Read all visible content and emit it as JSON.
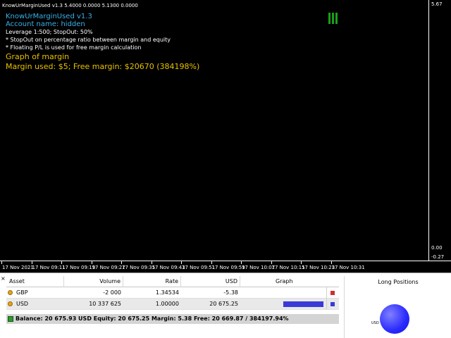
{
  "chart": {
    "header": "KnowUrMarginUsed v1.3 5.4000 0.0000 5.1300 0.0000",
    "info": {
      "version": "KnowUrMarginUsed v1.3",
      "account": "Account name: hidden",
      "leverage": "Leverage 1:500; StopOut: 50%",
      "note1": "* StopOut on percentage ratio between margin and equity",
      "note2": "* Floating P/L is used for free margin calculation",
      "graph_title": "Graph of margin",
      "margin_line": "Margin used: $5; Free margin: $20670 (384198%)"
    },
    "price_labels": [
      "5.67",
      "0.00",
      "-0.27"
    ],
    "time_labels": [
      "17 Nov 2021",
      "17 Nov 09:11",
      "17 Nov 09:19",
      "17 Nov 09:27",
      "17 Nov 09:35",
      "17 Nov 09:43",
      "17 Nov 09:51",
      "17 Nov 09:59",
      "17 Nov 10:07",
      "17 Nov 10:15",
      "17 Nov 10:23",
      "17 Nov 10:31"
    ],
    "indicator_color": "#19a019"
  },
  "panel": {
    "close_label": "×",
    "headers": {
      "asset": "Asset",
      "volume": "Volume",
      "rate": "Rate",
      "usd": "USD",
      "graph": "Graph"
    },
    "rows": [
      {
        "asset": "GBP",
        "volume": "-2 000",
        "rate": "1.34534",
        "usd": "-5.38",
        "fill": 0,
        "swatch": "#d03030"
      },
      {
        "asset": "USD",
        "volume": "10 337 625",
        "rate": "1.00000",
        "usd": "20 675.25",
        "fill": 1.0,
        "swatch": "#3a3ad8"
      }
    ],
    "balance": "Balance: 20 675.93 USD  Equity: 20 675.25  Margin: 5.38  Free: 20 669.87 / 384197.94%",
    "long_positions": {
      "title": "Long Positions",
      "label": "USD",
      "color": "#2a2aff"
    }
  }
}
